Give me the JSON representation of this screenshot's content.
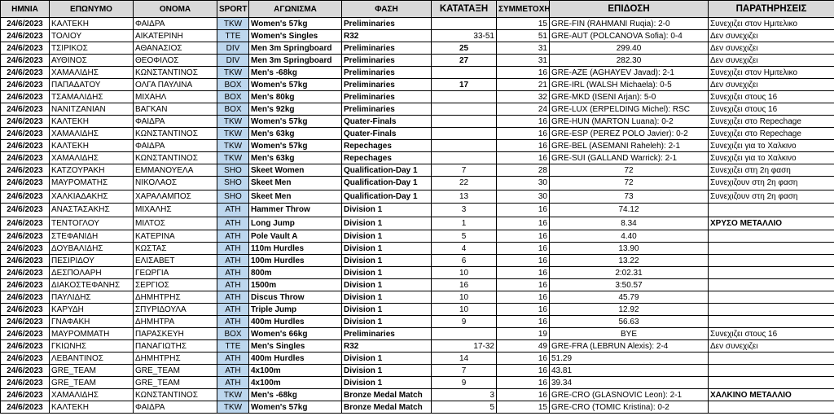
{
  "headers": [
    "ΗΜΝΙΑ",
    "ΕΠΩΝΥΜΟ",
    "ΟΝΟΜΑ",
    "SPORT",
    "ΑΓΩΝΙΣΜΑ",
    "ΦΑΣΗ",
    "ΚΑΤΑΤΑΞΗ",
    "ΣΥΜΜΕΤΟΧΗ",
    "ΕΠΙΔΟΣΗ",
    "ΠΑΡΑΤΗΡΗΣΕΙΣ"
  ],
  "colors": {
    "header_bg": "#d9d9d9",
    "sport_bg": "#bdd7ee",
    "grid": "#000000"
  },
  "rows": [
    [
      "24/6/2023",
      "ΚΑΛΤΕΚΗ",
      "ΦΑΙΔΡΑ",
      "TKW",
      "Women's 57kg",
      "Preliminaries",
      "",
      "15",
      "GRE-FIN (RAHMANI Ruqia): 2-0",
      "Συνεχιζει στον Ημιτελικο"
    ],
    [
      "24/6/2023",
      "ΤΟΛΙΟΥ",
      "ΑΙΚΑΤΕΡΙΝΗ",
      "TTE",
      "Women's Singles",
      "R32",
      "33-51",
      "51",
      "GRE-AUT (POLCANOVA Sofia): 0-4",
      "Δεν συνεχιζει"
    ],
    [
      "24/6/2023",
      "ΤΣΙΡΙΚΟΣ",
      "ΑΘΑΝΑΣΙΟΣ",
      "DIV",
      "Men 3m Springboard",
      "Preliminaries",
      "25",
      "31",
      "299.40",
      "Δεν συνεχιζει"
    ],
    [
      "24/6/2023",
      "ΑΥΘΙΝΟΣ",
      "ΘΕΟΦΙΛΟΣ",
      "DIV",
      "Men 3m Springboard",
      "Preliminaries",
      "27",
      "31",
      "282.30",
      "Δεν συνεχιζει"
    ],
    [
      "24/6/2023",
      "ΧΑΜΑΛΙΔΗΣ",
      "ΚΩΝΣΤΑΝΤΙΝΟΣ",
      "TKW",
      "Men's -68kg",
      "Preliminaries",
      "",
      "16",
      "GRE-AZE (AGHAYEV Javad): 2-1",
      "Συνεχιζει στον Ημιτελικο"
    ],
    [
      "24/6/2023",
      "ΠΑΠΑΔΑΤΟΥ",
      "ΟΛΓΑ ΠΑΥΛΙΝΑ",
      "BOX",
      "Women's 57kg",
      "Preliminaries",
      "17",
      "21",
      "GRE-IRL (WALSH Michaela): 0-5",
      "Δεν συνεχιζει"
    ],
    [
      "24/6/2023",
      "ΤΣΑΜΑΛΙΔΗΣ",
      "ΜΙΧΑΗΛ",
      "BOX",
      "Men's 80kg",
      "Preliminaries",
      "",
      "32",
      "GRE-MKD (ISENI Arjan): 5-0",
      "Συνεχιζει στους 16"
    ],
    [
      "24/6/2023",
      "ΝΑΝΙΤΖΑΝΙΑΝ",
      "ΒΑΓΚΑΝ",
      "BOX",
      "Men's 92kg",
      "Preliminaries",
      "",
      "24",
      "GRE-LUX (ERPELDING Michel): RSC",
      "Συνεχιζει στους 16"
    ],
    [
      "24/6/2023",
      "ΚΑΛΤΕΚΗ",
      "ΦΑΙΔΡΑ",
      "TKW",
      "Women's 57kg",
      "Quater-Finals",
      "",
      "16",
      "GRE-HUN (MARTON Luana): 0-2",
      "Συνεχιζει στο Repechage"
    ],
    [
      "24/6/2023",
      "ΧΑΜΑΛΙΔΗΣ",
      "ΚΩΝΣΤΑΝΤΙΝΟΣ",
      "TKW",
      "Men's 63kg",
      "Quater-Finals",
      "",
      "16",
      "GRE-ESP (PEREZ POLO Javier): 0-2",
      "Συνεχιζει στο Repechage"
    ],
    [
      "24/6/2023",
      "ΚΑΛΤΕΚΗ",
      "ΦΑΙΔΡΑ",
      "TKW",
      "Women's 57kg",
      "Repechages",
      "",
      "16",
      "GRE-BEL (ASEMANI Raheleh): 2-1",
      "Συνεχιζει για το Χαλκινο"
    ],
    [
      "24/6/2023",
      "ΧΑΜΑΛΙΔΗΣ",
      "ΚΩΝΣΤΑΝΤΙΝΟΣ",
      "TKW",
      "Men's 63kg",
      "Repechages",
      "",
      "16",
      "GRE-SUI (GALLAND Warrick): 2-1",
      "Συνεχιζει για το Χαλκινο"
    ],
    [
      "24/6/2023",
      "ΚΑΤΖΟΥΡΑΚΗ",
      "ΕΜΜΑΝΟΥΕΛΑ",
      "SHO",
      "Skeet Women",
      "Qualification-Day 1",
      "7",
      "28",
      "72",
      "Συνεχιζει στη 2η φαση"
    ],
    [
      "24/6/2023",
      "ΜΑΥΡΟΜΑΤΗΣ",
      "ΝΙΚΟΛΑΟΣ",
      "SHO",
      "Skeet Men",
      "Qualification-Day 1",
      "22",
      "30",
      "72",
      "Συνεχιζουν στη 2η φαση"
    ],
    [
      "24/6/2023",
      "ΧΑΛΚΙΑΔΑΚΗΣ",
      "ΧΑΡΑΛΑΜΠΟΣ",
      "SHO",
      "Skeet Men",
      "Qualification-Day 1",
      "13",
      "30",
      "73",
      "Συνεχιζουν στη 2η φαση"
    ],
    [
      "24/6/2023",
      "ΑΝΑΣΤΑΣΑΚΗΣ",
      "ΜΙΧΑΛΗΣ",
      "ATH",
      "Hammer Throw",
      "Division 1",
      "3",
      "16",
      "74.12",
      ""
    ],
    [
      "24/6/2023",
      "ΤΕΝΤΟΓΛΟΥ",
      "ΜΙΛΤΟΣ",
      "ATH",
      "Long Jump",
      "Division 1",
      "1",
      "16",
      "8.34",
      "ΧΡΥΣΟ ΜΕΤΑΛΛΙΟ"
    ],
    [
      "24/6/2023",
      "ΣΤΕΦΑΝΙΔΗ",
      "ΚΑΤΕΡΙΝΑ",
      "ATH",
      "Pole Vault A",
      "Division 1",
      "5",
      "16",
      "4.40",
      ""
    ],
    [
      "24/6/2023",
      "ΔΟΥΒΑΛΙΔΗΣ",
      "ΚΩΣΤΑΣ",
      "ATH",
      "110m Hurdles",
      "Division 1",
      "4",
      "16",
      "13.90",
      ""
    ],
    [
      "24/6/2023",
      "ΠΕΣΙΡΙΔΟΥ",
      "ΕΛΙΣΑΒΕΤ",
      "ATH",
      "100m Hurdles",
      "Division 1",
      "6",
      "16",
      "13.22",
      ""
    ],
    [
      "24/6/2023",
      "ΔΕΣΠΟΛΑΡΗ",
      "ΓΕΩΡΓΙΑ",
      "ATH",
      "800m",
      "Division 1",
      "10",
      "16",
      "2:02.31",
      ""
    ],
    [
      "24/6/2023",
      "ΔΙΑΚΟΣΤΕΦΑΝΗΣ",
      "ΣΕΡΓΙΟΣ",
      "ATH",
      "1500m",
      "Division 1",
      "16",
      "16",
      "3:50.57",
      ""
    ],
    [
      "24/6/2023",
      "ΠΑΥΛΙΔΗΣ",
      "ΔΗΜΗΤΡΗΣ",
      "ATH",
      "Discus Throw",
      "Division 1",
      "10",
      "16",
      "45.79",
      ""
    ],
    [
      "24/6/2023",
      "ΚΑΡΥΔΗ",
      "ΣΠΥΡΙΔΟΥΛΑ",
      "ATH",
      "Triple Jump",
      "Division 1",
      "10",
      "16",
      "12.92",
      ""
    ],
    [
      "24/6/2023",
      "ΓΝΑΦΑΚΗ",
      "ΔΗΜΗΤΡΑ",
      "ATH",
      "400m Hurdles",
      "Division 1",
      "9",
      "16",
      "56.63",
      ""
    ],
    [
      "24/6/2023",
      "ΜΑΥΡΟΜΜΑΤΗ",
      "ΠΑΡΑΣΚΕΥΗ",
      "BOX",
      "Women's 66kg",
      "Preliminaries",
      "",
      "19",
      "BYE",
      "Συνεχιζει στους 16"
    ],
    [
      "24/6/2023",
      "ΓΚΙΩΝΗΣ",
      "ΠΑΝΑΓΙΩΤΗΣ",
      "TTE",
      "Men's Singles",
      "R32",
      "17-32",
      "49",
      "GRE-FRA (LEBRUN Alexis): 2-4",
      "Δεν συνεχιζει"
    ],
    [
      "24/6/2023",
      "ΛΕΒΑΝΤΙΝΟΣ",
      "ΔΗΜΗΤΡΗΣ",
      "ATH",
      "400m Hurdles",
      "Division 1",
      "14",
      "16",
      "51.29",
      ""
    ],
    [
      "24/6/2023",
      "GRE_TEAM",
      "GRE_TEAM",
      "ATH",
      "4x100m",
      "Division 1",
      "7",
      "16",
      "43.81",
      ""
    ],
    [
      "24/6/2023",
      "GRE_TEAM",
      "GRE_TEAM",
      "ATH",
      "4x100m",
      "Division 1",
      "9",
      "16",
      "39.34",
      ""
    ],
    [
      "24/6/2023",
      "ΧΑΜΑΛΙΔΗΣ",
      "ΚΩΝΣΤΑΝΤΙΝΟΣ",
      "TKW",
      "Men's -68kg",
      "Bronze Medal Match",
      "3",
      "16",
      "GRE-CRO (GLASNOVIC Leon): 2-1",
      "ΧΑΛΚΙΝΟ ΜΕΤΑΛΛΙΟ"
    ],
    [
      "24/6/2023",
      "ΚΑΛΤΕΚΗ",
      "ΦΑΙΔΡΑ",
      "TKW",
      "Women's 57kg",
      "Bronze Medal Match",
      "5",
      "15",
      "GRE-CRO (TOMIC Kristina): 0-2",
      ""
    ]
  ]
}
